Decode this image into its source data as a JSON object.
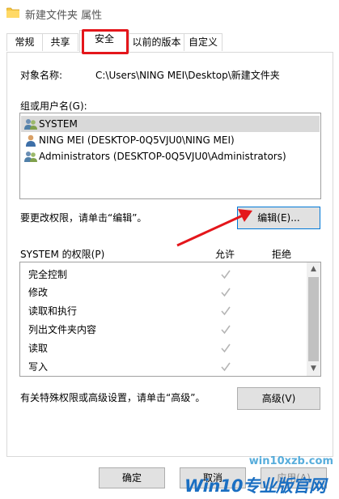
{
  "window": {
    "title": "新建文件夹 属性",
    "folder_icon": "folder-icon"
  },
  "tabs": [
    {
      "label": "常规",
      "active": false
    },
    {
      "label": "共享",
      "active": false
    },
    {
      "label": "安全",
      "active": true
    },
    {
      "label": "以前的版本",
      "active": false
    },
    {
      "label": "自定义",
      "active": false
    }
  ],
  "object": {
    "label": "对象名称:",
    "value": "C:\\Users\\NING MEI\\Desktop\\新建文件夹"
  },
  "groups": {
    "label": "组或用户名(G):",
    "items": [
      {
        "name": "SYSTEM",
        "icon": "users-group-icon",
        "selected": true
      },
      {
        "name": "NING MEI (DESKTOP-0Q5VJU0\\NING MEI)",
        "icon": "user-icon",
        "selected": false
      },
      {
        "name": "Administrators (DESKTOP-0Q5VJU0\\Administrators)",
        "icon": "users-group-icon",
        "selected": false
      }
    ]
  },
  "edit": {
    "hint": "要更改权限，请单击“编辑”。",
    "button_label": "编辑(E)..."
  },
  "permissions": {
    "title": "SYSTEM 的权限(P)",
    "allow_header": "允许",
    "deny_header": "拒绝",
    "rows": [
      {
        "name": "完全控制",
        "allow": true,
        "deny": false
      },
      {
        "name": "修改",
        "allow": true,
        "deny": false
      },
      {
        "name": "读取和执行",
        "allow": true,
        "deny": false
      },
      {
        "name": "列出文件夹内容",
        "allow": true,
        "deny": false
      },
      {
        "name": "读取",
        "allow": true,
        "deny": false
      },
      {
        "name": "写入",
        "allow": true,
        "deny": false
      }
    ]
  },
  "advanced": {
    "hint": "有关特殊权限或高级设置，请单击“高级”。",
    "button_label": "高级(V)"
  },
  "footer": {
    "ok_label": "确定",
    "cancel_label": "取消",
    "apply_label": "应用(A)"
  },
  "watermark": {
    "small": "win10xzb.com",
    "big": "Win10专业版官网"
  },
  "colors": {
    "highlight_box": "#e4161b",
    "arrow": "#e4161b",
    "selected_row": "#d9d9d9",
    "watermark": "#1b6fc2"
  }
}
